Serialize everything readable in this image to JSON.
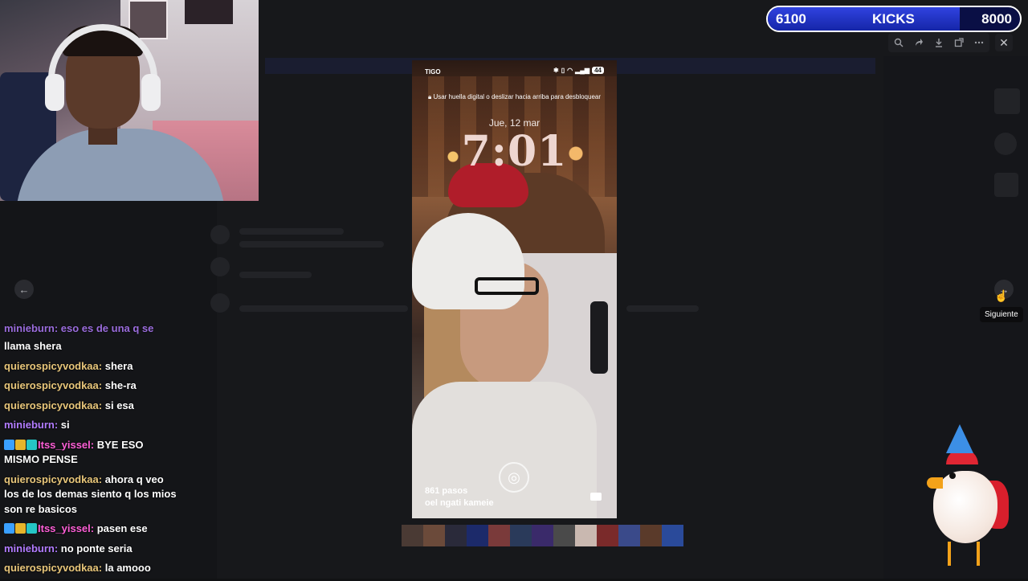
{
  "kicks": {
    "left": "6100",
    "label": "KICKS",
    "right": "8000",
    "progress": 0.7625
  },
  "viewer": {
    "tooltip": "Siguiente",
    "toolbar_icons": [
      "zoom-icon",
      "forward-icon",
      "download-icon",
      "open-external-icon",
      "more-icon"
    ]
  },
  "chat": {
    "first_partial": "minieburn: eso es de una q se",
    "messages": [
      {
        "user": "",
        "text": "llama shera",
        "color": "pink",
        "badges": false
      },
      {
        "user": "quierospicyvodkaa:",
        "text": "shera",
        "color": "gold",
        "badges": false
      },
      {
        "user": "quierospicyvodkaa:",
        "text": "she-ra",
        "color": "gold",
        "badges": false
      },
      {
        "user": "quierospicyvodkaa:",
        "text": "si esa",
        "color": "gold",
        "badges": false
      },
      {
        "user": "minieburn:",
        "text": "si",
        "color": "purple",
        "badges": false
      },
      {
        "user": "Itss_yissel:",
        "text": "BYE ESO MISMO PENSE",
        "color": "magenta",
        "badges": true
      },
      {
        "user": "quierospicyvodkaa:",
        "text": "ahora q veo los de los demas siento q los mios son re basicos",
        "color": "gold",
        "badges": false
      },
      {
        "user": "Itss_yissel:",
        "text": "pasen ese",
        "color": "magenta",
        "badges": true
      },
      {
        "user": "minieburn:",
        "text": "no ponte seria",
        "color": "purple",
        "badges": false
      },
      {
        "user": "quierospicyvodkaa:",
        "text": "la amooo",
        "color": "gold",
        "badges": false
      }
    ]
  },
  "phone": {
    "carrier": "TIGO",
    "battery": "44",
    "lock_hint": "Usar huella digital o deslizar hacia arriba para desbloquear",
    "date": "Jue, 12 mar",
    "time": "7:01",
    "steps": "861 pasos",
    "music": "oel ngati kameie"
  },
  "thumbnails": [
    "#4a3a34",
    "#6b4a3a",
    "#2a2a3a",
    "#1c2a6a",
    "#7a3a3a",
    "#2a3a5a",
    "#3a2a6a",
    "#4a4a4a",
    "#c9b8b0",
    "#7a2a2a",
    "#3a4a8a",
    "#5a3a2a",
    "#2a4a9a"
  ]
}
